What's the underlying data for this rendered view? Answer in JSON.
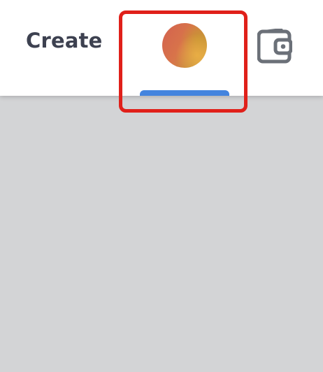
{
  "header": {
    "create_label": "Create"
  },
  "nav": {
    "profile_icon": "avatar",
    "wallet_icon": "wallet-icon"
  },
  "colors": {
    "text": "#3d4150",
    "active_indicator": "#4384de",
    "highlight": "#e0201a",
    "icon": "#6b7078",
    "backdrop": "#d3d4d6"
  }
}
